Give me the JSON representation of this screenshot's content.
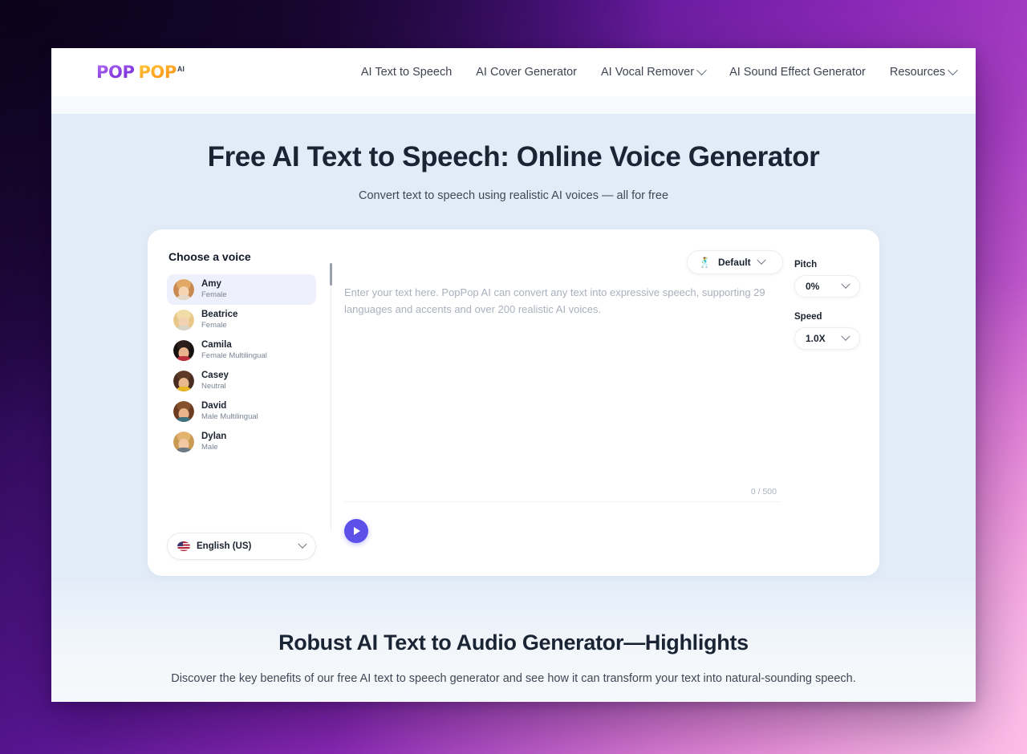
{
  "header": {
    "logo": {
      "part1": "POP",
      "part2": "POP",
      "sup": "AI"
    },
    "nav": [
      {
        "label": "AI Text to Speech",
        "has_caret": false
      },
      {
        "label": "AI Cover Generator",
        "has_caret": false
      },
      {
        "label": "AI Vocal Remover",
        "has_caret": true
      },
      {
        "label": "AI Sound Effect Generator",
        "has_caret": false
      },
      {
        "label": "Resources",
        "has_caret": true
      }
    ]
  },
  "hero": {
    "title": "Free AI Text to Speech: Online Voice Generator",
    "subtitle": "Convert text to speech using realistic AI voices — all for free"
  },
  "tool": {
    "choose_voice_label": "Choose a voice",
    "voices": [
      {
        "name": "Amy",
        "type": "Female",
        "selected": true,
        "hair": "#c98a52",
        "skin": "#f5d3b3",
        "shirt": "#e7d9c8"
      },
      {
        "name": "Beatrice",
        "type": "Female",
        "selected": false,
        "hair": "#e8c88a",
        "skin": "#f3d2b4",
        "shirt": "#d8d3c6"
      },
      {
        "name": "Camila",
        "type": "Female Multilingual",
        "selected": false,
        "hair": "#17110f",
        "skin": "#e8b48d",
        "shirt": "#b9303a"
      },
      {
        "name": "Casey",
        "type": "Neutral",
        "selected": false,
        "hair": "#4a2d20",
        "skin": "#e9b98e",
        "shirt": "#e8b626"
      },
      {
        "name": "David",
        "type": "Male Multilingual",
        "selected": false,
        "hair": "#6b3b22",
        "skin": "#eab38a",
        "shirt": "#3e6f7d"
      },
      {
        "name": "Dylan",
        "type": "Male",
        "selected": false,
        "hair": "#c99a52",
        "skin": "#f0c8a2",
        "shirt": "#6d7a86"
      }
    ],
    "language": {
      "label": "English (US)",
      "flag_icon": "us-flag-icon"
    },
    "style": {
      "label": "Default",
      "emoji": "🕺"
    },
    "textarea": {
      "placeholder": "Enter your text here. PopPop AI can convert any text into expressive speech, supporting 29 languages and accents and over 200 realistic AI voices.",
      "counter": "0 / 500"
    },
    "controls": [
      {
        "label": "Pitch",
        "value": "0%"
      },
      {
        "label": "Speed",
        "value": "1.0X"
      }
    ],
    "play_button_icon": "play-icon"
  },
  "bottom": {
    "title": "Robust AI Text to Audio Generator—Highlights",
    "subtitle": "Discover the key benefits of our free AI text to speech generator and see how it can transform your text into natural-sounding speech."
  },
  "colors": {
    "accent": "#5b51e8",
    "hero_bg": "#e2ecf8",
    "logo_purple": "#8a3fe0",
    "logo_orange": "#ffa423"
  }
}
